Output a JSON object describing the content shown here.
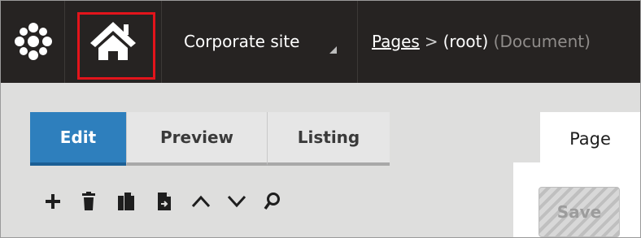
{
  "header": {
    "site_name": "Corporate site",
    "breadcrumb": {
      "link": "Pages",
      "separator": ">",
      "current": "(root)",
      "type": "(Document)"
    }
  },
  "toolbar": {
    "tabs": [
      {
        "label": "Edit",
        "active": true
      },
      {
        "label": "Preview",
        "active": false
      },
      {
        "label": "Listing",
        "active": false
      }
    ],
    "icons": [
      "plus-icon",
      "trash-icon",
      "copy-icon",
      "move-icon",
      "arrow-up-icon",
      "arrow-down-icon",
      "search-icon"
    ]
  },
  "panel": {
    "tab_label": "Page",
    "save_label": "Save"
  },
  "colors": {
    "topbar": "#262322",
    "active_tab": "#2e7fbd",
    "highlight": "#e3141b",
    "content_bg": "#dededd"
  }
}
